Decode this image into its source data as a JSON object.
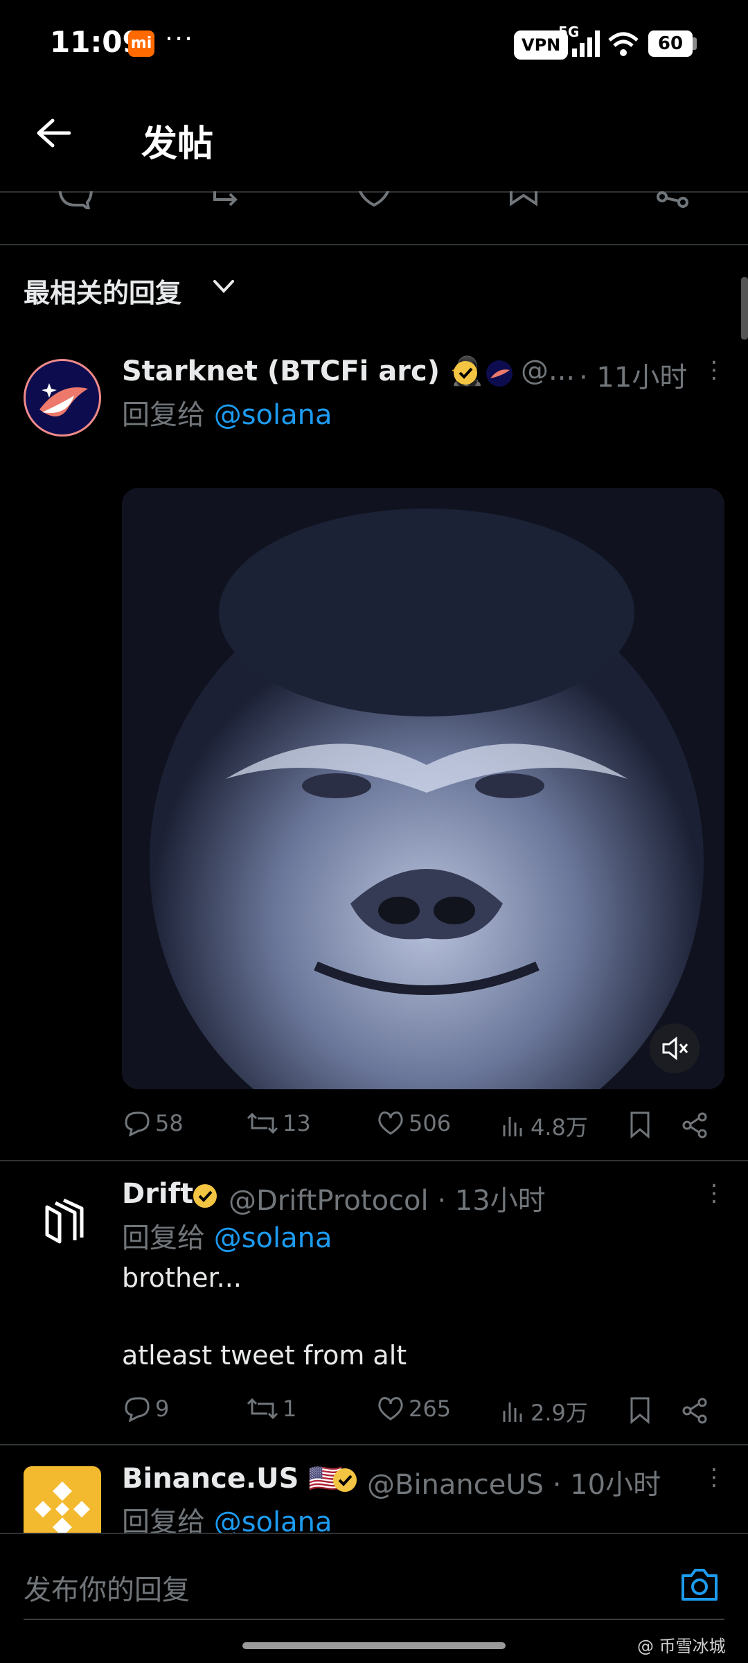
{
  "status_bar": {
    "time": "11:09",
    "mi_label": "mi",
    "dots": "···",
    "vpn": "VPN",
    "network": "5G",
    "battery": "60"
  },
  "header": {
    "title": "发帖"
  },
  "sort": {
    "label": "最相关的回复"
  },
  "posts": [
    {
      "name": "Starknet (BTCFi arc) 🥷",
      "handle": "@...",
      "time": "· 11小时",
      "reply_prefix": "回复给 ",
      "reply_to": "@solana",
      "metrics": {
        "replies": "58",
        "reposts": "13",
        "likes": "506",
        "views": "4.8万"
      }
    },
    {
      "name": "Drift",
      "handle": "@DriftProtocol · 13小时",
      "reply_prefix": "回复给 ",
      "reply_to": "@solana",
      "text_line1": "brother...",
      "text_line2": "atleast tweet from alt",
      "metrics": {
        "replies": "9",
        "reposts": "1",
        "likes": "265",
        "views": "2.9万"
      }
    },
    {
      "name": "Binance.US 🇺🇸",
      "handle": "@BinanceUS · 10小时",
      "reply_prefix": "回复给 ",
      "reply_to": "@solana"
    }
  ],
  "reply_bar": {
    "placeholder": "发布你的回复"
  },
  "watermark": "@ 币雪冰城",
  "colors": {
    "accent": "#1d9bf0",
    "verified": "#f4c542",
    "muted": "#71767b"
  }
}
